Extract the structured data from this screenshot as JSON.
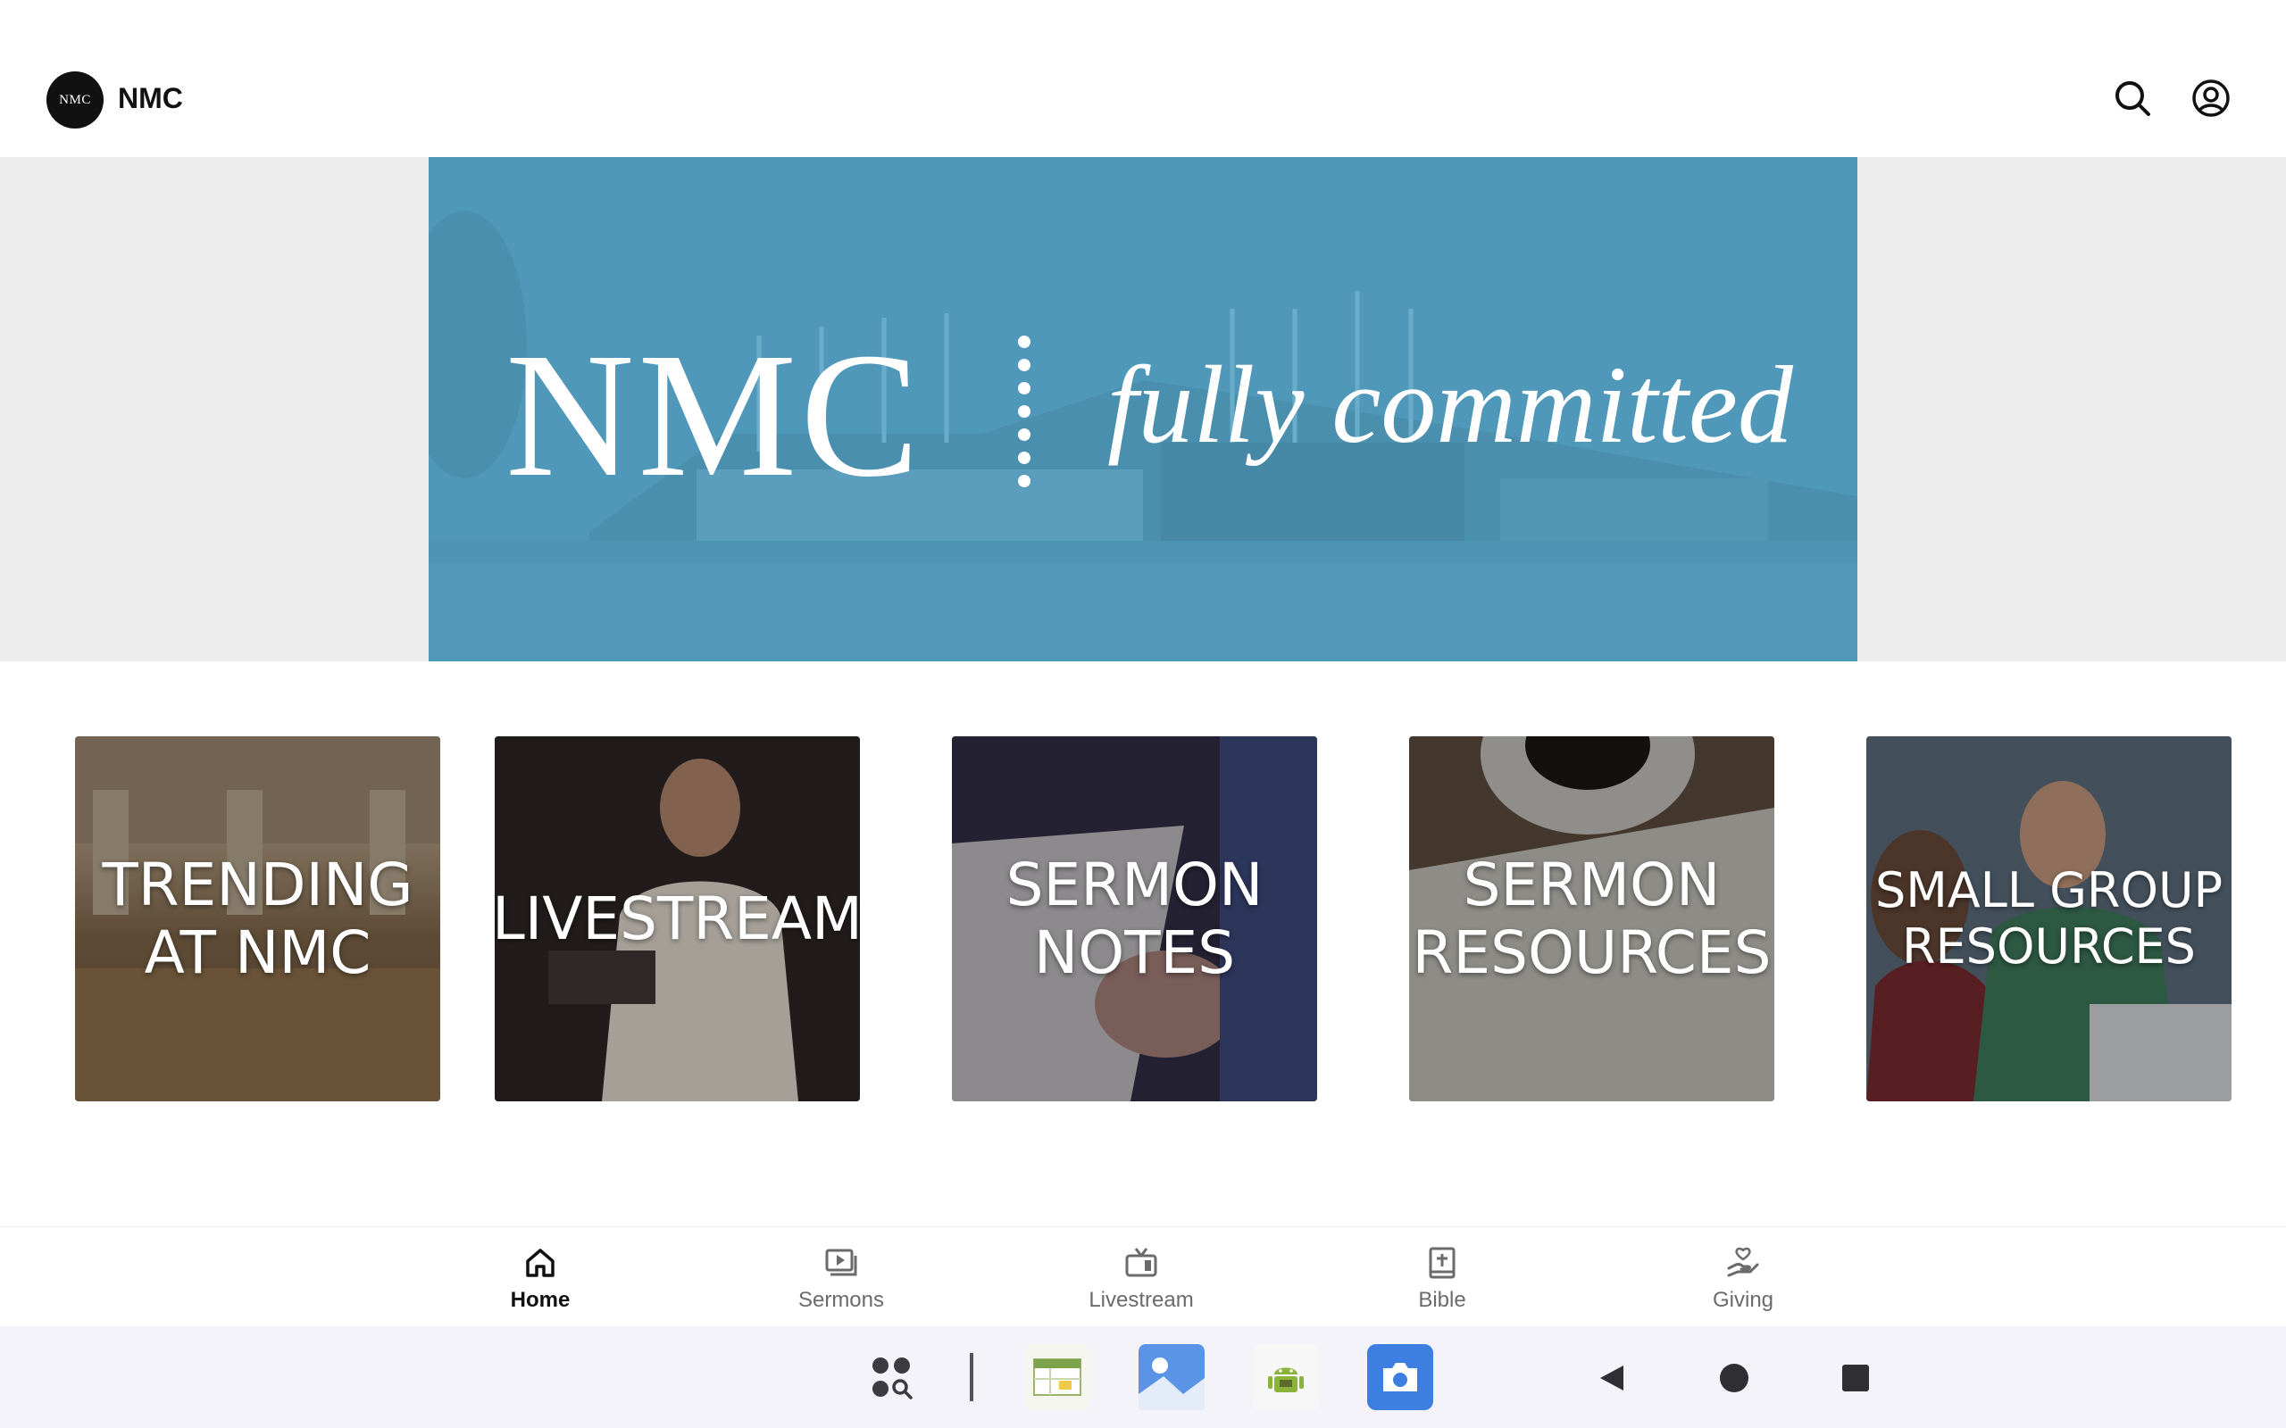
{
  "app": {
    "logo_text": "NMC",
    "title": "NMC"
  },
  "header": {
    "search_icon": "search-icon",
    "account_icon": "account-circle-icon"
  },
  "hero": {
    "logo": "NMC",
    "tagline": "fully committed",
    "color": "#5098b9"
  },
  "tiles": [
    {
      "line1": "TRENDING",
      "line2": "AT NMC"
    },
    {
      "line1": "LIVESTREAM",
      "line2": ""
    },
    {
      "line1": "SERMON",
      "line2": "NOTES"
    },
    {
      "line1": "SERMON",
      "line2": "RESOURCES"
    },
    {
      "line1": "SMALL GROUP",
      "line2": "RESOURCES"
    }
  ],
  "bottom_nav": {
    "items": [
      {
        "label": "Home",
        "icon": "home-icon",
        "active": true
      },
      {
        "label": "Sermons",
        "icon": "video-library-icon",
        "active": false
      },
      {
        "label": "Livestream",
        "icon": "tv-icon",
        "active": false
      },
      {
        "label": "Bible",
        "icon": "bible-icon",
        "active": false
      },
      {
        "label": "Giving",
        "icon": "giving-hand-icon",
        "active": false
      }
    ]
  },
  "taskbar": {
    "items": [
      "app-search-icon",
      "sheets-app-icon",
      "gallery-app-icon",
      "android-app-icon",
      "camera-app-icon"
    ],
    "nav": [
      "back-icon",
      "home-circle-icon",
      "recents-icon"
    ]
  }
}
